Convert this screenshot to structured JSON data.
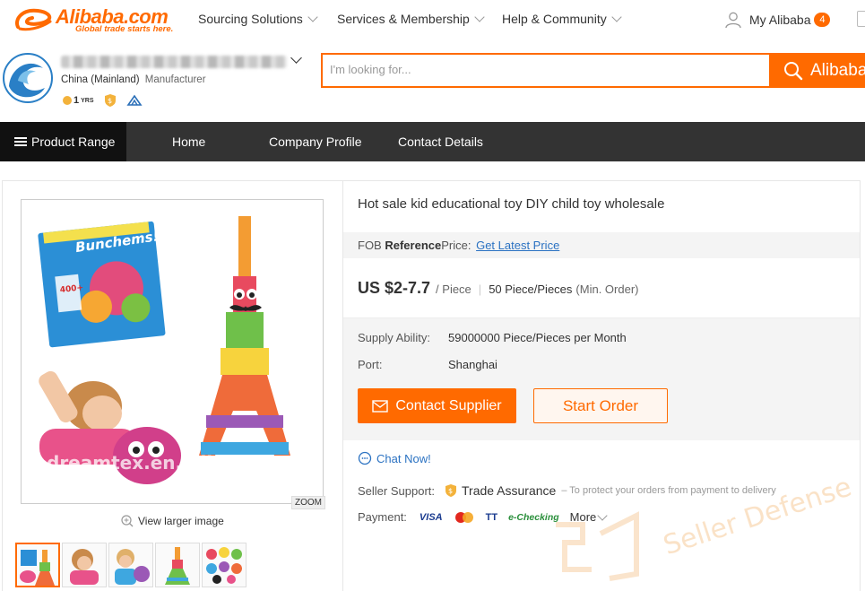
{
  "colors": {
    "accent": "#ff6a00",
    "link": "#2b72c2",
    "dark_nav": "#333333"
  },
  "top_nav": {
    "logo_text": "Alibaba.com",
    "logo_tagline": "Global trade starts here.",
    "items": [
      {
        "label": "Sourcing Solutions"
      },
      {
        "label": "Services & Membership"
      },
      {
        "label": "Help & Community"
      }
    ],
    "my_alibaba": "My Alibaba",
    "message_count": "4"
  },
  "company": {
    "country": "China (Mainland)",
    "type": "Manufacturer",
    "years": "1",
    "years_unit": "YRS"
  },
  "search": {
    "placeholder": "I'm looking for...",
    "button_label": "Alibaba"
  },
  "store_nav": {
    "items": [
      {
        "label": "Product Range"
      },
      {
        "label": "Home"
      },
      {
        "label": "Company Profile"
      },
      {
        "label": "Contact Details"
      }
    ]
  },
  "gallery": {
    "zoom_label": "ZOOM",
    "view_larger": "View larger image",
    "image_watermark": "dreamtex.en.alibaba.com",
    "box_brand": "Bunchems!"
  },
  "product": {
    "title": "Hot sale kid educational toy DIY child toy wholesale",
    "fob_prefix": "FOB",
    "fob_bold": "Reference",
    "fob_suffix": "Price:",
    "fob_link": "Get Latest Price",
    "price": "US $2-7.7",
    "price_unit": "/ Piece",
    "min_order_qty": "50 Piece/Pieces",
    "min_order_label": "(Min. Order)",
    "supply_label": "Supply Ability:",
    "supply_value": "59000000 Piece/Pieces per Month",
    "port_label": "Port:",
    "port_value": "Shanghai",
    "contact_button": "Contact Supplier",
    "order_button": "Start Order",
    "chat_label": "Chat Now!",
    "seller_support_label": "Seller Support:",
    "trade_assurance": "Trade Assurance",
    "trade_assurance_note": "– To protect your orders from payment to delivery",
    "payment_label": "Payment:",
    "payment_methods": [
      "VISA",
      "TT",
      "e-Checking"
    ],
    "more_label": "More"
  },
  "watermark_text": "Seller Defense"
}
